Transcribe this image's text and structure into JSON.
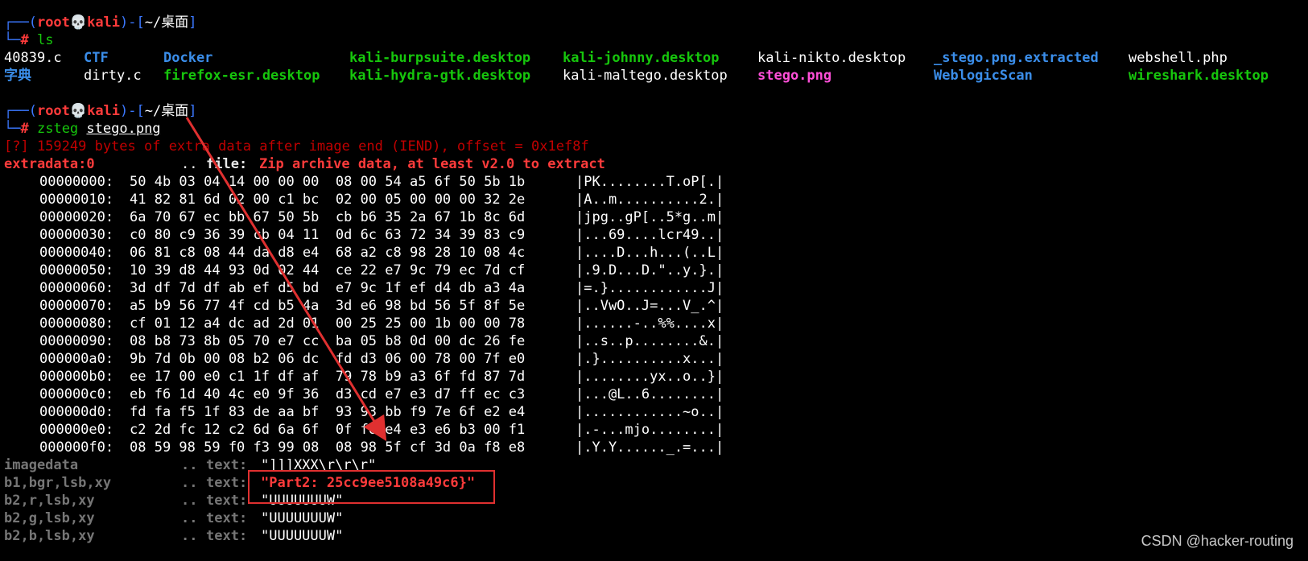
{
  "prompt": {
    "open": "┌──(",
    "user": "root",
    "skull": "💀",
    "host": "kali",
    "mid": ")-[",
    "path": "~/桌面",
    "close": "]",
    "corner": "└─",
    "hash": "#"
  },
  "commands": {
    "ls": "ls",
    "zsteg_cmd": "zsteg",
    "zsteg_arg": "stego.png"
  },
  "ls_output": {
    "row1": [
      "40839.c",
      "CTF",
      "Docker",
      "kali-burpsuite.desktop",
      "kali-johnny.desktop",
      "kali-nikto.desktop",
      "_stego.png.extracted",
      "webshell.php"
    ],
    "row2": [
      "字典",
      "dirty.c",
      "firefox-esr.desktop",
      "kali-hydra-gtk.desktop",
      "kali-maltego.desktop",
      "stego.png",
      "WeblogicScan",
      "wireshark.desktop"
    ]
  },
  "zsteg": {
    "warning": "[?] 159249 bytes of extra data after image end (IEND), offset = 0x1ef8f",
    "extradata_label": "extradata:0",
    "dots": "..",
    "file_label": "file:",
    "file_value": "Zip archive data, at least v2.0 to extract",
    "hexdump": [
      {
        "addr": "00000000:",
        "bytes": "50 4b 03 04 14 00 00 00  08 00 54 a5 6f 50 5b 1b",
        "ascii": "|PK........T.oP[.|"
      },
      {
        "addr": "00000010:",
        "bytes": "41 82 81 6d 02 00 c1 bc  02 00 05 00 00 00 32 2e",
        "ascii": "|A..m..........2.|"
      },
      {
        "addr": "00000020:",
        "bytes": "6a 70 67 ec bb 67 50 5b  cb b6 35 2a 67 1b 8c 6d",
        "ascii": "|jpg..gP[..5*g..m|"
      },
      {
        "addr": "00000030:",
        "bytes": "c0 80 c9 36 39 cb 04 11  0d 6c 63 72 34 39 83 c9",
        "ascii": "|...69....lcr49..|"
      },
      {
        "addr": "00000040:",
        "bytes": "06 81 c8 08 44 da d8 e4  68 a2 c8 98 28 10 08 4c",
        "ascii": "|....D...h...(..L|"
      },
      {
        "addr": "00000050:",
        "bytes": "10 39 d8 44 93 0d 02 44  ce 22 e7 9c 79 ec 7d cf",
        "ascii": "|.9.D...D.\"..y.}.|"
      },
      {
        "addr": "00000060:",
        "bytes": "3d df 7d df ab ef d5 bd  e7 9c 1f ef d4 db a3 4a",
        "ascii": "|=.}............J|"
      },
      {
        "addr": "00000070:",
        "bytes": "a5 b9 56 77 4f cd b5 4a  3d e6 98 bd 56 5f 8f 5e",
        "ascii": "|..VwO..J=...V_.^|"
      },
      {
        "addr": "00000080:",
        "bytes": "cf 01 12 a4 dc ad 2d 01  00 25 25 00 1b 00 00 78",
        "ascii": "|......-..%%....x|"
      },
      {
        "addr": "00000090:",
        "bytes": "08 b8 73 8b 05 70 e7 cc  ba 05 b8 0d 00 dc 26 fe",
        "ascii": "|..s..p........&.|"
      },
      {
        "addr": "000000a0:",
        "bytes": "9b 7d 0b 00 08 b2 06 dc  fd d3 06 00 78 00 7f e0",
        "ascii": "|.}..........x...|"
      },
      {
        "addr": "000000b0:",
        "bytes": "ee 17 00 e0 c1 1f df af  79 78 b9 a3 6f fd 87 7d",
        "ascii": "|........yx..o..}|"
      },
      {
        "addr": "000000c0:",
        "bytes": "eb f6 1d 40 4c e0 9f 36  d3 cd e7 e3 d7 ff ec c3",
        "ascii": "|...@L..6........|"
      },
      {
        "addr": "000000d0:",
        "bytes": "fd fa f5 1f 83 de aa bf  93 93 bb f9 7e 6f e2 e4",
        "ascii": "|............~o..|"
      },
      {
        "addr": "000000e0:",
        "bytes": "c2 2d fc 12 c2 6d 6a 6f  0f f6 e4 e3 e6 b3 00 f1",
        "ascii": "|.-...mjo........|"
      },
      {
        "addr": "000000f0:",
        "bytes": "08 59 98 59 f0 f3 99 08  08 98 5f cf 3d 0a f8 e8",
        "ascii": "|.Y.Y......_.=...|"
      }
    ],
    "results": [
      {
        "label": "imagedata",
        "dots": "..",
        "kind": "text:",
        "value": "\"]]]XXX\\r\\r\\r\""
      },
      {
        "label": "b1,bgr,lsb,xy",
        "dots": "..",
        "kind": "text:",
        "value": "\"Part2: 25cc9ee5108a49c6}\""
      },
      {
        "label": "b2,r,lsb,xy",
        "dots": "..",
        "kind": "text:",
        "value": "\"UUUUUUUW\""
      },
      {
        "label": "b2,g,lsb,xy",
        "dots": "..",
        "kind": "text:",
        "value": "\"UUUUUUUW\""
      },
      {
        "label": "b2,b,lsb,xy",
        "dots": "..",
        "kind": "text:",
        "value": "\"UUUUUUUW\""
      }
    ]
  },
  "watermark": "CSDN @hacker-routing",
  "colors": {
    "background": "#000000",
    "prompt_frame": "#3b78ff",
    "prompt_user": "#ff3b3b",
    "command": "#16c60c",
    "warning": "#c00000",
    "highlight": "#e03030",
    "arrow": "#e03030"
  }
}
